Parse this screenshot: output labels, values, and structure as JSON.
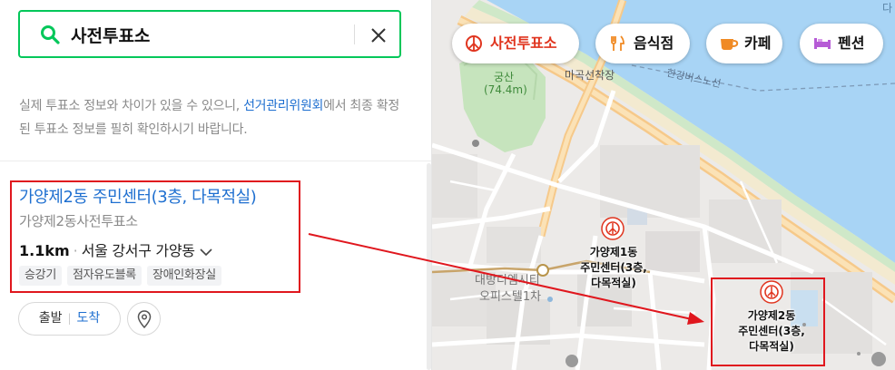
{
  "search": {
    "query": "사전투표소",
    "placeholder": ""
  },
  "notice": {
    "text_before": "실제 투표소 정보와 차이가 있을 수 있으니, ",
    "link": "선거관리위원회",
    "text_after": "에서 최종 확정된 투표소 정보를 필히 확인하시기 바랍니다."
  },
  "result": {
    "title": "가양제2동 주민센터(3층, 다목적실)",
    "subtitle": "가양제2동사전투표소",
    "distance": "1.1km",
    "address": "서울 강서구 가양동",
    "tags": [
      "승강기",
      "점자유도블록",
      "장애인화장실"
    ],
    "route_depart": "출발",
    "route_arrive": "도착"
  },
  "map": {
    "chips": [
      {
        "label": "사전투표소",
        "icon": "vote-icon",
        "color": "#e0351f",
        "active": true
      },
      {
        "label": "음식점",
        "icon": "fork-knife-icon",
        "color": "#f08a24"
      },
      {
        "label": "카페",
        "icon": "cup-icon",
        "color": "#f08a24"
      },
      {
        "label": "펜션",
        "icon": "bed-icon",
        "color": "#b65bd6"
      }
    ],
    "labels": {
      "gungsan": "궁산",
      "gungsan_height": "(74.4m)",
      "magok_dock": "마곡선착장",
      "bus_route": "한강버스노선",
      "daebang": "대방디엠시티",
      "officetel": "오피스텔1차",
      "corner_char": "다"
    },
    "poi1": [
      "가양제1동",
      "주민센터(3층,",
      "다목적실)"
    ],
    "poi2": [
      "가양제2동",
      "주민센터(3층,",
      "다목적실)"
    ]
  },
  "colors": {
    "accent": "#03c75a",
    "link": "#1e6fd0",
    "highlight": "#e0171e",
    "river": "#a8d4f5"
  }
}
